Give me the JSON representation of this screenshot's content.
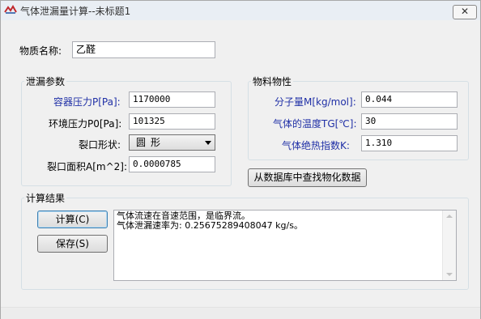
{
  "window": {
    "title": "气体泄漏量计算--未标题1",
    "close_symbol": "✕",
    "icon": "app-logo-icon"
  },
  "substance": {
    "label": "物质名称:",
    "value": "乙醛"
  },
  "leak_params": {
    "group_title": "泄漏参数",
    "pressure_label": "容器压力P[Pa]:",
    "pressure_value": "1170000",
    "ambient_label": "环境压力P0[Pa]:",
    "ambient_value": "101325",
    "shape_label": "裂口形状:",
    "shape_value": "圆形",
    "area_label": "裂口面积A[m^2]:",
    "area_value": "0.0000785"
  },
  "material_props": {
    "group_title": "物料物性",
    "mw_label": "分子量M[kg/mol]:",
    "mw_value": "0.044",
    "temp_label": "气体的温度TG[℃]:",
    "temp_value": "30",
    "k_label": "气体绝热指数K:",
    "k_value": "1.310",
    "lookup_button": "从数据库中查找物化数据"
  },
  "results": {
    "group_title": "计算结果",
    "calc_button": "计算(C)",
    "save_button": "保存(S)",
    "line1": "气体流速在音速范围，是临界流。",
    "line2": "气体泄漏速率为: 0.25675289408047 kg/s。"
  }
}
